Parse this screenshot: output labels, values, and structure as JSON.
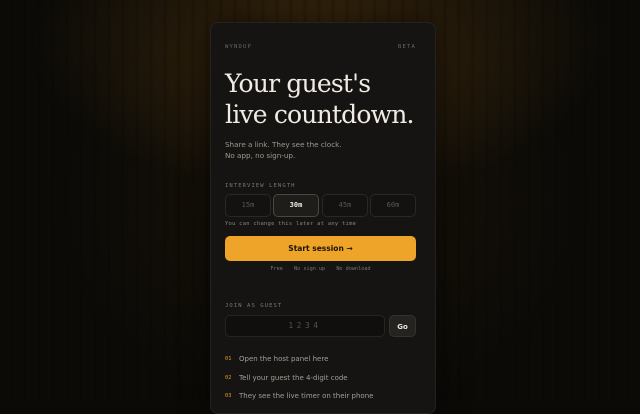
{
  "app": {
    "brand": "WYNDUP",
    "version": "BETA"
  },
  "hero": {
    "title_line1": "Your guest's",
    "title_line2": "live countdown.",
    "subtitle_line1": "Share a link. They see the clock.",
    "subtitle_line2": "No app, no sign-up."
  },
  "interview": {
    "label": "INTERVIEW LENGTH",
    "options": [
      "15m",
      "30m",
      "45m",
      "60m"
    ],
    "selected": "30m",
    "hint": "You can change this later at any time"
  },
  "start": {
    "label": "Start session →"
  },
  "features": [
    "Free",
    "No sign up",
    "No download"
  ],
  "join": {
    "label": "JOIN AS GUEST",
    "placeholder": "1234",
    "go_label": "Go"
  },
  "steps": [
    {
      "num": "01",
      "text": "Open the host panel here"
    },
    {
      "num": "02",
      "text": "Tell your guest the 4-digit code"
    },
    {
      "num": "03",
      "text": "They see the live timer on their phone"
    }
  ],
  "colors": {
    "accent": "#eea428",
    "background": "#0b0a07",
    "card": "#151412"
  }
}
